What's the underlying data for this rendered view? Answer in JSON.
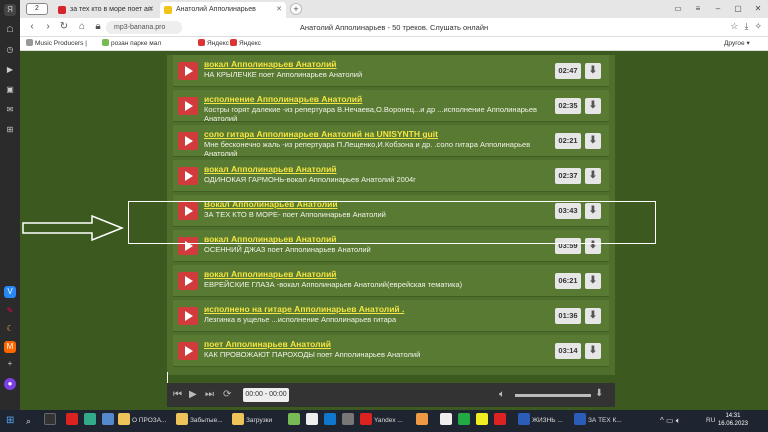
{
  "browser": {
    "tab_count": "2",
    "tabs": [
      {
        "title": "за тех кто в море поет ап",
        "active": false,
        "color": "#d6262b"
      },
      {
        "title": "Анатолий Апполинарьев",
        "active": true,
        "color": "#f0c419"
      }
    ],
    "url": "mp3-banana.pro",
    "page_title": "Анатолий Апполинарьев - 50 треков. Слушать онлайн",
    "bookmarks": [
      "Music Producers |",
      "розан парке мал",
      "Яндекс",
      "Яндекс"
    ],
    "other_bookmarks": "Другое"
  },
  "tracks": [
    {
      "title": "вокал Апполинарьев Анатолий",
      "desc": "НА КРЫЛЕЧКЕ поет Апполинарьев Анатолий",
      "duration": "02:47"
    },
    {
      "title": "исполнение Апполинарьев Анатолий",
      "desc": "Костры горят далекие -из репертуара В.Нечаева,О.Воронец...и др ...исполнение Апполинарьев Анатолий",
      "duration": "02:35"
    },
    {
      "title": "соло гитара Апполинарьев Анатолий на UNISYNTH guit",
      "desc": "Мне бесконечно жаль -из репертуара П.Лещенко,И.Кобзона и др. .соло гитара Апполинарьев Анатолий",
      "duration": "02:21"
    },
    {
      "title": "вокал Апполинарьев Анатолий",
      "desc": "ОДИНОКАЯ ГАРМОНЬ-вокал Апполинарьев Анатолий 2004г",
      "duration": "02:37"
    },
    {
      "title": "Вокал Апполинарьев Анатолий",
      "desc": "ЗА ТЕХ КТО В МОРЕ- поет Апполинарьев Анатолий",
      "duration": "03:43"
    },
    {
      "title": "вокал Апполинарьев Анатолий",
      "desc": "ОСЕННИЙ ДЖАЗ поет Апполинарьев Анатолий",
      "duration": "03:59"
    },
    {
      "title": "вокал Апполинарьев Анатолий",
      "desc": "ЕВРЕЙСКИЕ ГЛАЗА -вокал Апполинарьев Анатолий(еврейская тематика)",
      "duration": "06:21"
    },
    {
      "title": "исполнено на гитаре Апполинарьев Анатолий .",
      "desc": "Лезгинка в ущелье ...исполнение Апполинарьев гитара",
      "duration": "01:36"
    },
    {
      "title": "поет Апполинарьев Анатолий",
      "desc": "КАК ПРОВОЖАЮТ ПАРОХОДЫ поет Апполинарьев Анатолий",
      "duration": "03:14"
    }
  ],
  "player": {
    "time": "00:00 - 00:00"
  },
  "taskbar": {
    "items": [
      "О ПРОЗА...",
      "Забытые...",
      "Загрузки",
      "Yandex ...",
      "ЖИЗНЬ ...",
      "ЗА ТЕХ К..."
    ],
    "lang": "RU",
    "time": "14:31",
    "date": "16.06.2023"
  }
}
